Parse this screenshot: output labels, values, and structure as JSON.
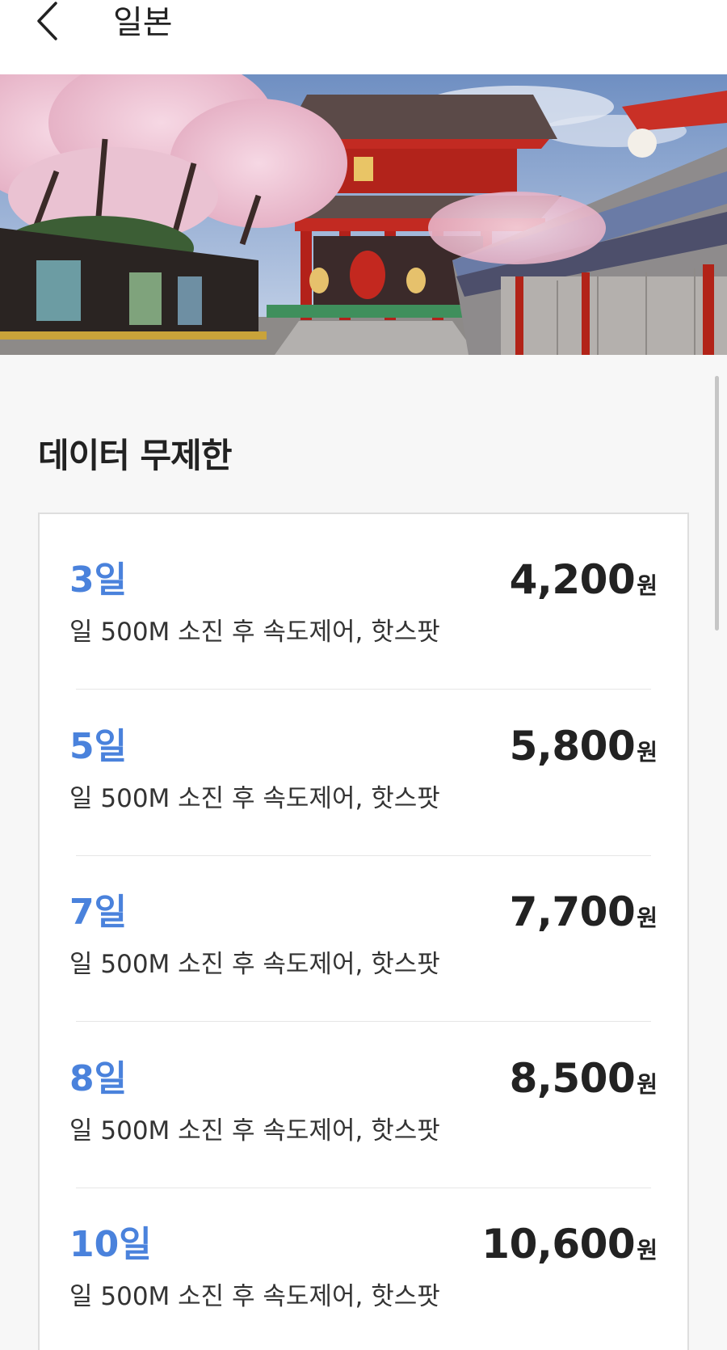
{
  "header": {
    "title": "일본",
    "back_icon": "chevron-left-icon"
  },
  "hero": {
    "description_icon": "japan-temple-cherry-blossom-photo"
  },
  "section": {
    "title": "데이터 무제한"
  },
  "plans": [
    {
      "days": "3일",
      "description": "일 500M 소진 후 속도제어, 핫스팟",
      "price": "4,200",
      "unit": "원"
    },
    {
      "days": "5일",
      "description": "일 500M 소진 후 속도제어, 핫스팟",
      "price": "5,800",
      "unit": "원"
    },
    {
      "days": "7일",
      "description": "일 500M 소진 후 속도제어, 핫스팟",
      "price": "7,700",
      "unit": "원"
    },
    {
      "days": "8일",
      "description": "일 500M 소진 후 속도제어, 핫스팟",
      "price": "8,500",
      "unit": "원"
    },
    {
      "days": "10일",
      "description": "일 500M 소진 후 속도제어, 핫스팟",
      "price": "10,600",
      "unit": "원"
    }
  ],
  "colors": {
    "accent": "#4a82dc",
    "text": "#222222",
    "background": "#f7f7f7",
    "card": "#ffffff",
    "border": "#dedede"
  }
}
